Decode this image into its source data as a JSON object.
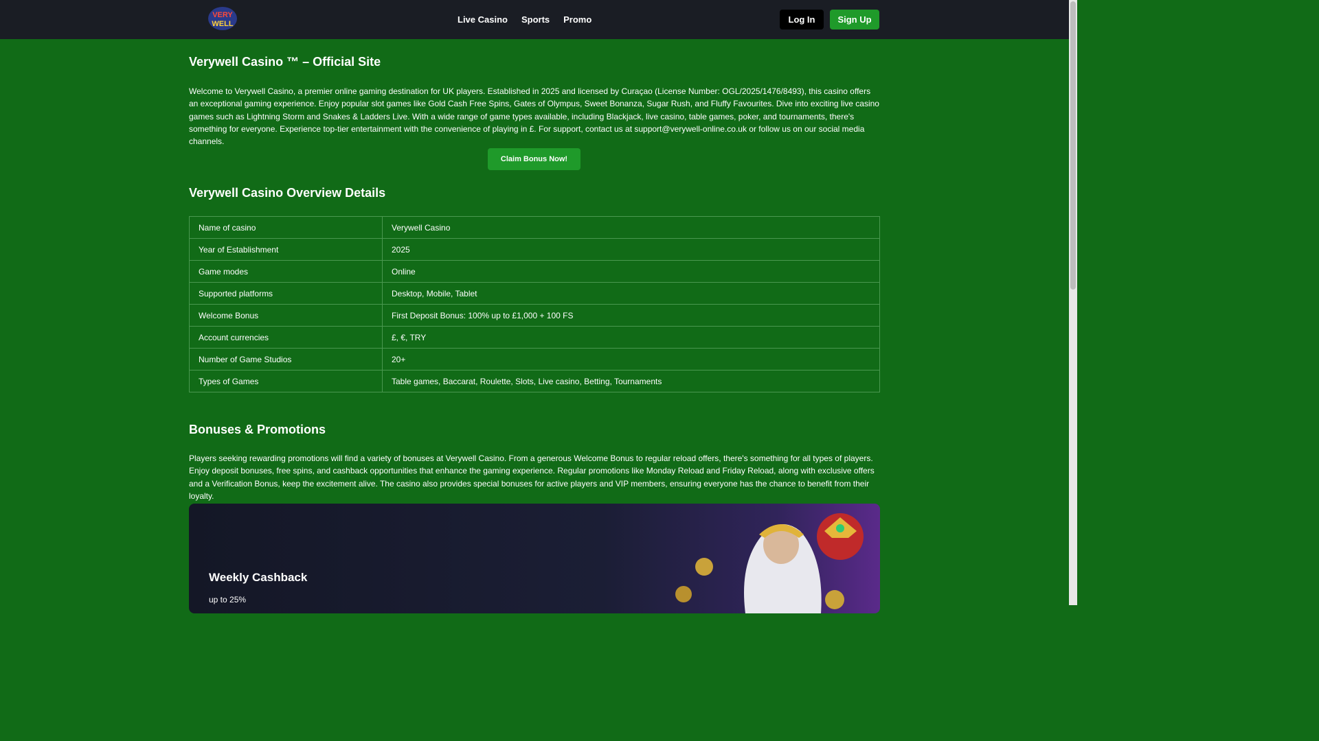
{
  "header": {
    "logo_text": "VERY WELL",
    "nav": [
      "Live Casino",
      "Sports",
      "Promo"
    ],
    "login_label": "Log In",
    "signup_label": "Sign Up"
  },
  "intro": {
    "title": "Verywell Casino ™ – Official Site",
    "paragraph": "Welcome to Verywell Casino, a premier online gaming destination for UK players. Established in 2025 and licensed by Curaçao (License Number: OGL/2025/1476/8493), this casino offers an exceptional gaming experience. Enjoy popular slot games like Gold Cash Free Spins, Gates of Olympus, Sweet Bonanza, Sugar Rush, and Fluffy Favourites. Dive into exciting live casino games such as Lightning Storm and Snakes & Ladders Live. With a wide range of game types available, including Blackjack, live casino, table games, poker, and tournaments, there's something for everyone. Experience top-tier entertainment with the convenience of playing in £. For support, contact us at support@verywell-online.co.uk or follow us on our social media channels.",
    "cta_label": "Claim Bonus Now!"
  },
  "overview": {
    "title": "Verywell Casino Overview Details",
    "rows": [
      {
        "key": "Name of casino",
        "value": "Verywell Casino"
      },
      {
        "key": "Year of Establishment",
        "value": "2025"
      },
      {
        "key": "Game modes",
        "value": "Online"
      },
      {
        "key": "Supported platforms",
        "value": "Desktop, Mobile, Tablet"
      },
      {
        "key": "Welcome Bonus",
        "value": "First Deposit Bonus: 100% up to £1,000 + 100 FS"
      },
      {
        "key": "Account currencies",
        "value": "£, €, TRY"
      },
      {
        "key": "Number of Game Studios",
        "value": "20+"
      },
      {
        "key": "Types of Games",
        "value": "Table games, Baccarat, Roulette, Slots, Live casino, Betting, Tournaments"
      }
    ]
  },
  "bonuses": {
    "title": "Bonuses & Promotions",
    "paragraph": "Players seeking rewarding promotions will find a variety of bonuses at Verywell Casino. From a generous Welcome Bonus to regular reload offers, there's something for all types of players. Enjoy deposit bonuses, free spins, and cashback opportunities that enhance the gaming experience. Regular promotions like Monday Reload and Friday Reload, along with exclusive offers and a Verification Bonus, keep the excitement alive. The casino also provides special bonuses for active players and VIP members, ensuring everyone has the chance to benefit from their loyalty.",
    "card": {
      "title": "Weekly Cashback",
      "subtitle": "up to 25%"
    }
  },
  "colors": {
    "background": "#116b17",
    "header": "#1a1d24",
    "accent": "#1f9a2a"
  }
}
